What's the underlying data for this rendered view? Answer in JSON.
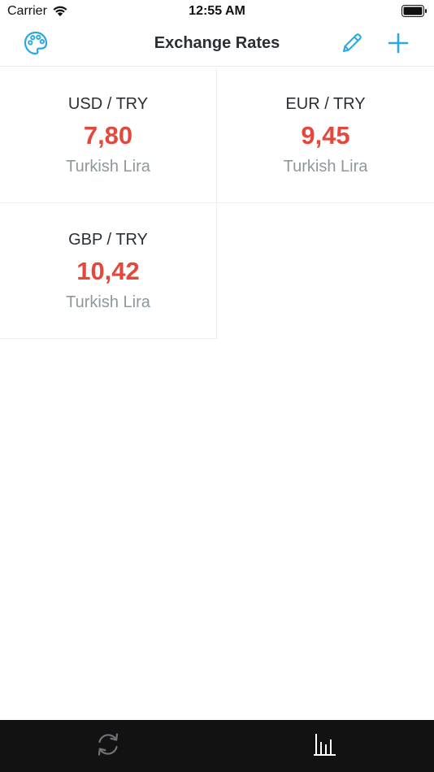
{
  "status_bar": {
    "carrier": "Carrier",
    "time": "12:55 AM",
    "icons": [
      "wifi-icon",
      "battery-icon"
    ]
  },
  "nav": {
    "title": "Exchange Rates",
    "left_icon": "palette-icon",
    "right_icons": [
      "pencil-icon",
      "plus-icon"
    ],
    "accent_color": "#2aa9e0"
  },
  "rates": [
    {
      "pair": "USD / TRY",
      "value": "7,80",
      "currency_name": "Turkish Lira"
    },
    {
      "pair": "EUR / TRY",
      "value": "9,45",
      "currency_name": "Turkish Lira"
    },
    {
      "pair": "GBP / TRY",
      "value": "10,42",
      "currency_name": "Turkish Lira"
    }
  ],
  "colors": {
    "rate_value": "#e4473c",
    "currency_name": "#8e989c",
    "tab_bar_bg": "#121212"
  },
  "tab_bar": {
    "items": [
      "refresh-icon",
      "bar-chart-icon"
    ]
  }
}
